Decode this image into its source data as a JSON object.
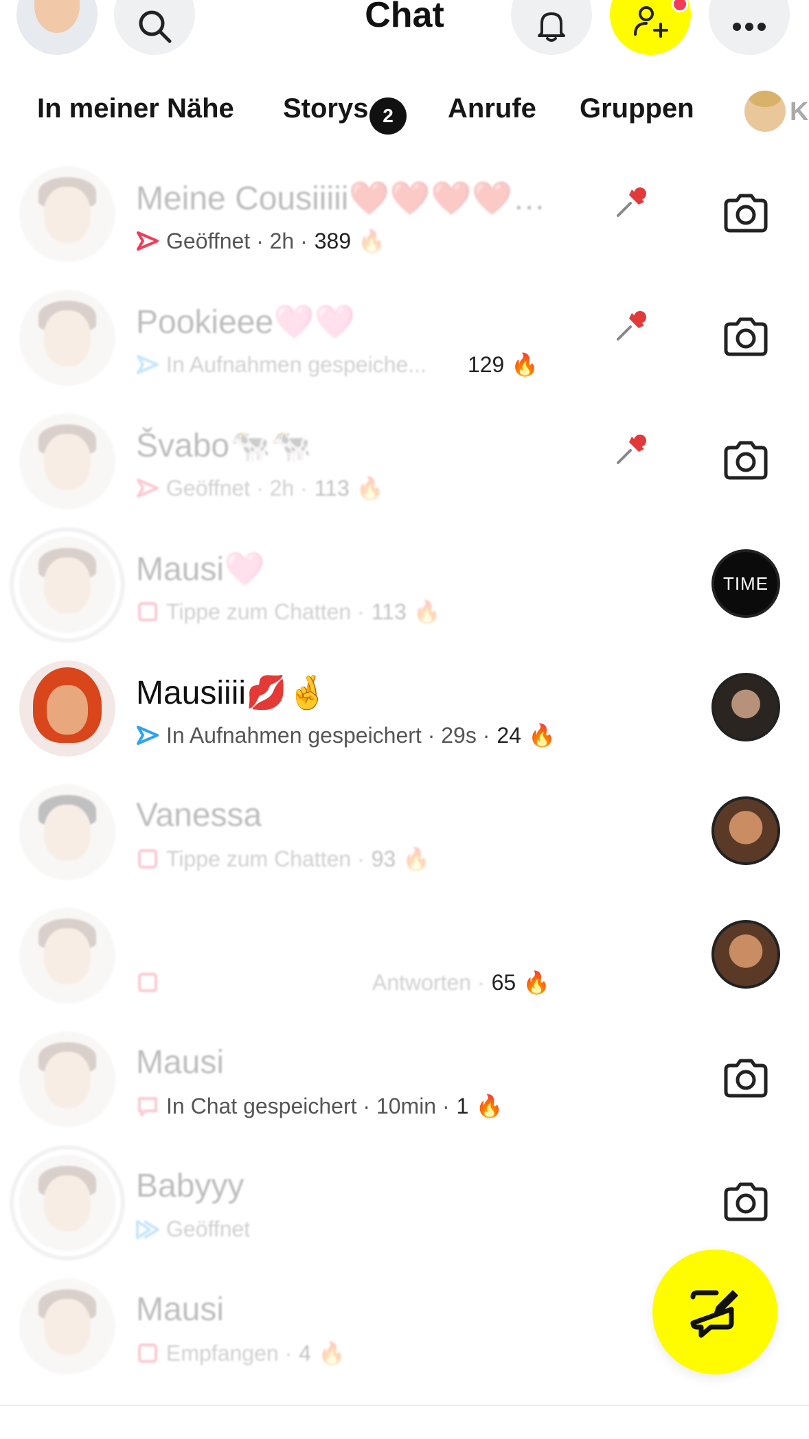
{
  "header": {
    "title": "Chat",
    "icons": [
      "avatar",
      "search-icon",
      "bell-icon",
      "add-friend-icon",
      "more-icon"
    ],
    "accent_color": "#fffc00",
    "notification_color": "#f23c57"
  },
  "tabs": [
    {
      "label": "In meiner Nähe"
    },
    {
      "label": "Storys",
      "badge": "2"
    },
    {
      "label": "Anrufe"
    },
    {
      "label": "Gruppen"
    },
    {
      "label": "K"
    }
  ],
  "chats": [
    {
      "name": "Meine Cousiiiii❤️❤️❤️❤️…",
      "status_icon": "sent-red-arrow-icon",
      "status": "Geöffnet · 2h ·",
      "streak": "389",
      "pinned": true,
      "action": "camera-icon",
      "faded": true
    },
    {
      "name": "Pookieee🩷🩷",
      "status_icon": "sent-blue-arrow-icon",
      "status": "In Aufnahmen gespeiche...",
      "streak": "129",
      "pinned": true,
      "action": "camera-icon",
      "faded": true
    },
    {
      "name": "Švabo🐄🐄",
      "status_icon": "sent-red-arrow-icon",
      "status": "Geöffnet · 2h ·",
      "streak": "113",
      "pinned": true,
      "action": "camera-icon",
      "faded": true
    },
    {
      "name": "Mausi🩷",
      "status_icon": "chat-red-box-icon",
      "status": "Tippe zum Chatten ·",
      "streak": "113",
      "pinned": false,
      "action": "story-time",
      "action_text": "TIME",
      "faded": true
    },
    {
      "name": "Mausiiii💋🤞",
      "status_icon": "sent-blue-arrow-icon",
      "status": "In Aufnahmen gespeichert · 29s ·",
      "streak": "24",
      "pinned": false,
      "action": "story-man",
      "faded": false
    },
    {
      "name": "Vanessa",
      "status_icon": "chat-red-box-icon",
      "status": "Tippe zum Chatten ·",
      "streak": "93",
      "pinned": false,
      "action": "story-face",
      "faded": true
    },
    {
      "name": "",
      "status_icon": "chat-red-box-icon",
      "status": "Antworten ·",
      "streak": "65",
      "pinned": false,
      "action": "story-face",
      "faded": true
    },
    {
      "name": "Mausi",
      "status_icon": "chat-red-speech-icon",
      "status": "In Chat gespeichert · 10min ·",
      "streak": "1",
      "pinned": false,
      "action": "camera-icon",
      "faded": true
    },
    {
      "name": "Babyyy",
      "status_icon": "sent-blue-double-icon",
      "status": "Geöffnet",
      "streak": "",
      "pinned": false,
      "action": "camera-icon",
      "faded": true
    },
    {
      "name": "Mausi",
      "status_icon": "chat-red-box-icon",
      "status": "Empfangen ·",
      "streak": "4",
      "pinned": false,
      "action": "none",
      "faded": true
    }
  ],
  "streak_emoji": "🔥",
  "fab": {
    "icon": "compose-chat-icon"
  }
}
